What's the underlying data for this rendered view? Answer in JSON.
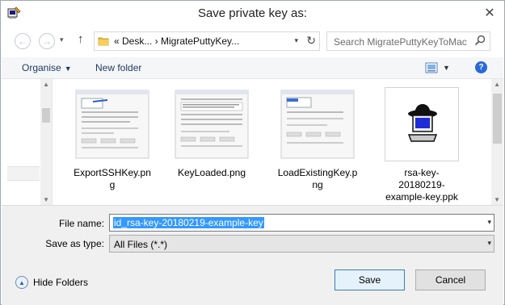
{
  "window": {
    "title": "Save private key as:",
    "close_glyph": "✕"
  },
  "nav": {
    "back_glyph": "←",
    "forward_glyph": "→",
    "dropdown_glyph": "▾",
    "up_glyph": "↑",
    "breadcrumb": "«  Desk...  ›  MigratePuttyKey...",
    "address_dropdown_glyph": "▾",
    "refresh_glyph": "↻",
    "search_placeholder": "Search MigratePuttyKeyToMac"
  },
  "toolbar": {
    "organise_label": "Organise",
    "caret": "▼",
    "new_folder_label": "New folder",
    "view_dropdown_glyph": "▼",
    "help_glyph": "?"
  },
  "files": [
    {
      "name": "ExportSSHKey.png",
      "icon": "screenshot-thumbnail"
    },
    {
      "name": "KeyLoaded.png",
      "icon": "screenshot-thumbnail"
    },
    {
      "name": "LoadExistingKey.png",
      "icon": "screenshot-thumbnail"
    },
    {
      "name": "rsa-key-20180219-example-key.ppk",
      "icon": "putty-key-icon"
    }
  ],
  "form": {
    "file_name_label": "File name:",
    "file_name_value": "id_rsa-key-20180219-example-key",
    "save_as_type_label": "Save as type:",
    "save_as_type_value": "All Files (*.*)",
    "dropdown_glyph": "▾"
  },
  "footer": {
    "hide_folders_label": "Hide Folders",
    "hide_folders_glyph": "▲",
    "save_label": "Save",
    "cancel_label": "Cancel"
  },
  "scroll": {
    "up_glyph": "▲",
    "down_glyph": "▼"
  },
  "colors": {
    "accent": "#3399ff",
    "help": "#2a6ad5",
    "link_text": "#1e395b"
  }
}
